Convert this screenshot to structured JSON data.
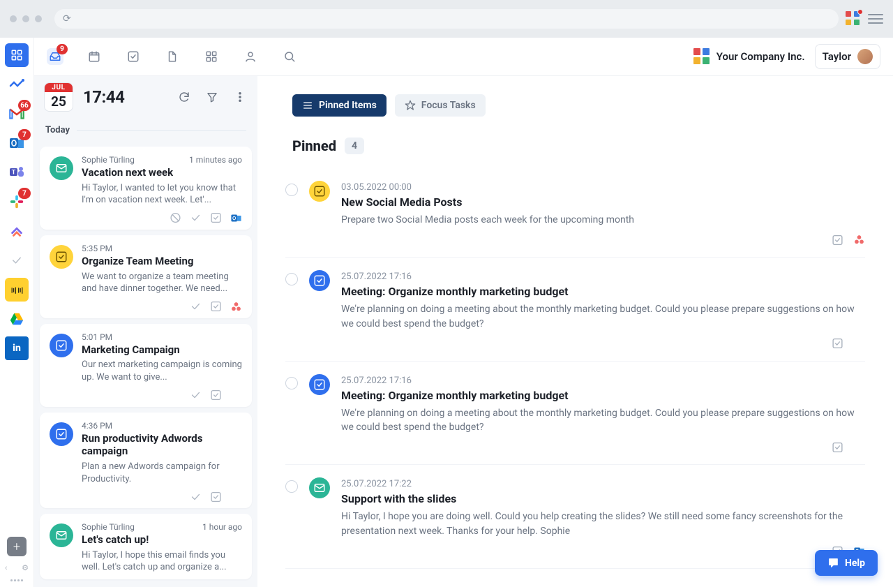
{
  "browser": {
    "refresh_glyph": "⟳"
  },
  "rail": {
    "items": [
      {
        "name": "home",
        "badge": null,
        "active": true
      },
      {
        "name": "analytics",
        "badge": null
      },
      {
        "name": "gmail",
        "badge": "66"
      },
      {
        "name": "outlook",
        "badge": "7"
      },
      {
        "name": "teams",
        "badge": null
      },
      {
        "name": "slack",
        "badge": "7"
      },
      {
        "name": "clickup",
        "badge": null
      },
      {
        "name": "tasks-grey",
        "badge": null
      },
      {
        "name": "miro",
        "badge": null
      },
      {
        "name": "google-drive",
        "badge": null
      },
      {
        "name": "linkedin",
        "badge": null
      }
    ]
  },
  "topnav": {
    "inbox_badge": "9",
    "company": "Your Company Inc.",
    "user": "Taylor"
  },
  "inbox": {
    "month": "JUL",
    "day": "25",
    "time": "17:44",
    "section": "Today",
    "cards": [
      {
        "icon_bg": "bg-green",
        "icon_type": "mail",
        "sender": "Sophie Türling",
        "time": "1 minutes ago",
        "title": "Vacation next week",
        "preview": "Hi Taylor, I wanted to let you know that I'm on vacation next week. Let'...",
        "actions": [
          "block",
          "check",
          "box",
          "outlook"
        ]
      },
      {
        "icon_bg": "bg-yellow",
        "icon_type": "task-check",
        "sender": "",
        "time": "5:35 PM",
        "title": "Organize Team Meeting",
        "preview": "We want to organize a team meeting and have dinner together. We need...",
        "actions": [
          "check",
          "box",
          "asana"
        ]
      },
      {
        "icon_bg": "bg-blue",
        "icon_type": "task-check",
        "sender": "",
        "time": "5:01 PM",
        "title": "Marketing Campaign",
        "preview": "Our next marketing campaign is coming up. We want to give...",
        "actions": [
          "check",
          "box",
          "clickup"
        ]
      },
      {
        "icon_bg": "bg-blue",
        "icon_type": "task-check",
        "sender": "",
        "time": "4:36 PM",
        "title": "Run productivity Adwords campaign",
        "preview": "Plan a new Adwords campaign for Productivity.",
        "actions": [
          "check",
          "box",
          "clickup"
        ]
      },
      {
        "icon_bg": "bg-green",
        "icon_type": "mail",
        "sender": "Sophie Türling",
        "time": "1 hour ago",
        "title": "Let's catch up!",
        "preview": "Hi Taylor, I hope this email finds you well. Let's catch up and organize a...",
        "actions": []
      }
    ]
  },
  "tabs": {
    "pinned": "Pinned Items",
    "focus": "Focus Tasks"
  },
  "pinned": {
    "heading": "Pinned",
    "count": "4",
    "items": [
      {
        "icon_bg": "bg-yellow",
        "icon_type": "task-check",
        "date": "03.05.2022 00:00",
        "title": "New Social Media Posts",
        "desc": "Prepare two Social Media posts each week for the upcoming month",
        "trailing": [
          "box",
          "asana"
        ]
      },
      {
        "icon_bg": "bg-blue",
        "icon_type": "task-check",
        "date": "25.07.2022 17:16",
        "title": "Meeting: Organize monthly marketing budget",
        "desc": "We're planning on doing a meeting about the monthly marketing budget. Could you please prepare suggestions on how we could best spend the budget?",
        "trailing": [
          "box",
          "clickup"
        ]
      },
      {
        "icon_bg": "bg-blue",
        "icon_type": "task-check",
        "date": "25.07.2022 17:16",
        "title": "Meeting: Organize monthly marketing budget",
        "desc": "We're planning on doing a meeting about the monthly marketing budget. Could you please prepare suggestions on how we could best spend the budget?",
        "trailing": [
          "box",
          "clickup"
        ]
      },
      {
        "icon_bg": "bg-green",
        "icon_type": "mail",
        "date": "25.07.2022 17:22",
        "title": "Support with the slides",
        "desc": "Hi Taylor, I hope you are doing well. Could you help creating the slides? We still need some fancy screenshots for the presentation next week. Thanks for your help. Sophie",
        "trailing": [
          "box",
          "outlook"
        ]
      }
    ]
  },
  "help": "Help"
}
